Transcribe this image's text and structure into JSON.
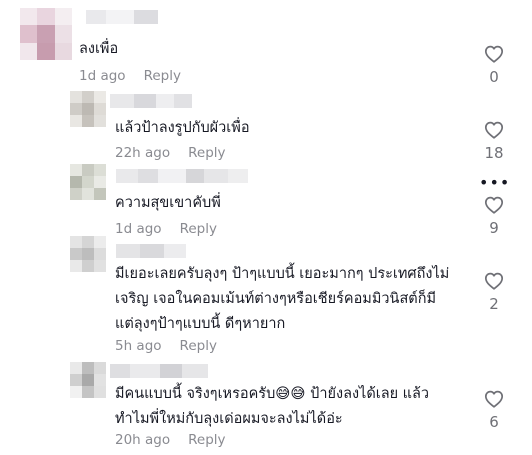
{
  "comments": [
    {
      "text_lines": [
        "ลงเพื่อ"
      ],
      "time": "1d ago",
      "reply": "Reply",
      "likes": "0",
      "avatar_colors": [
        "#f2e8ed",
        "#e9d5df",
        "#f4eef1",
        "#dfc0cd",
        "#c9a0b2",
        "#ece0e6",
        "#f1e7ec",
        "#c79cae",
        "#e8d9e0"
      ],
      "name_colors": [
        "#e9e9ec",
        "#f3f3f5",
        "#dcdce0"
      ]
    },
    {
      "text_lines": [
        "แล้วป้าลงรูปกับผัวเพื่อ"
      ],
      "time": "22h ago",
      "reply": "Reply",
      "likes": "18",
      "avatar_colors": [
        "#e4e2de",
        "#d2cfca",
        "#ebe9e5",
        "#cfccc7",
        "#bdb9b3",
        "#dedbd6",
        "#e9e7e3",
        "#c6c2bc",
        "#e2e0dc"
      ],
      "name_colors": [
        "#e8e8ea",
        "#d8d8dc",
        "#eeeef0",
        "#e1e1e4"
      ]
    },
    {
      "text_lines": [
        "ความสุขเขาคับพี่"
      ],
      "time": "1d ago",
      "reply": "Reply",
      "likes": "9",
      "more": "•••",
      "avatar_colors": [
        "#e6e7e1",
        "#c9cbc2",
        "#dcded6",
        "#b5b8ad",
        "#d3d6cc",
        "#e9eae5",
        "#cfd1c8",
        "#e1e3dc",
        "#c3c6bb"
      ],
      "name_colors": [
        "#e9e9eb",
        "#dedee1",
        "#f1f1f3",
        "#d6d6d9",
        "#e6e6e8",
        "#eeeeef"
      ]
    },
    {
      "text_lines": [
        "มีเยอะเลยครับลุงๆ ป้าๆแบบนี้ เยอะมากๆ ประเทศถึงไม่",
        "เจริญ เจอในคอมเม้นท์ต่างๆหรือเชียร์คอมมิวนิสต์ก็มี",
        "แต่ลุงๆป้าๆแบบนี้ ดีๆหายาก"
      ],
      "time": "5h ago",
      "reply": "Reply",
      "likes": "2",
      "avatar_colors": [
        "#e4e4e4",
        "#d5d5d5",
        "#ececec",
        "#c9c9c9",
        "#bdbdbd",
        "#dcdcdc",
        "#e9e9e9",
        "#cfcfcf",
        "#e1e1e1"
      ],
      "name_colors": [
        "#e4e4e6",
        "#d9d9dc",
        "#ececee"
      ]
    },
    {
      "text_lines": [
        "มีคนแบบนี้ จริงๆเหรอครับ😅😅 ป้ายังลงได้เลย แล้ว",
        "ทำไมพี่ใหม่กับลุงเด่อผมจะลงไม่ได้อ่ะ"
      ],
      "time": "20h ago",
      "reply": "Reply",
      "likes": "6",
      "avatar_colors": [
        "#e9e9e9",
        "#bdbdbd",
        "#dadada",
        "#cfcfcf",
        "#a9a9a9",
        "#e2e2e2",
        "#f1f1f1",
        "#c4c4c4",
        "#e0e0e0"
      ],
      "name_colors": [
        "#dedee1",
        "#eaeaec",
        "#d2d2d6",
        "#e6e6e8"
      ]
    }
  ]
}
